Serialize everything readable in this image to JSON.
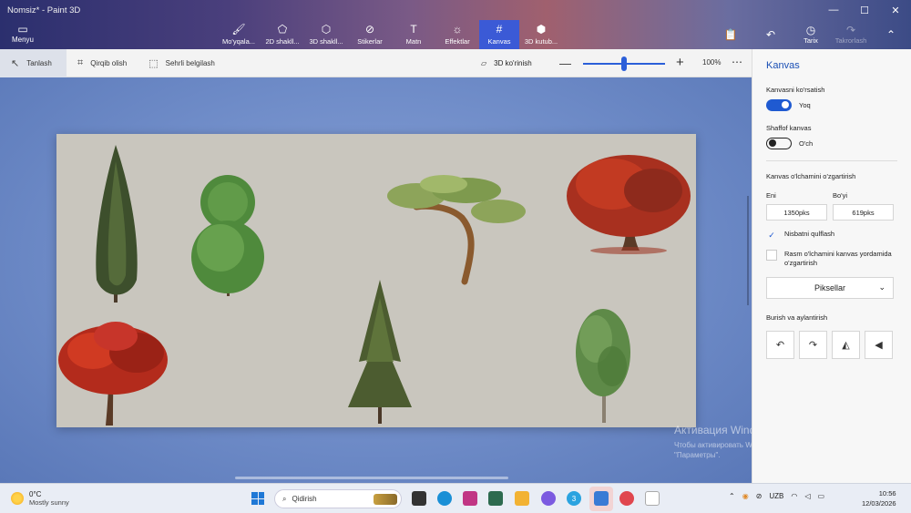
{
  "window": {
    "title": "Nomsiz* - Paint 3D"
  },
  "menu": {
    "label": "Menyu",
    "icon": "folder-icon"
  },
  "toolbar": {
    "tools": [
      {
        "label": "Mo'yqala...",
        "icon": "brush-icon"
      },
      {
        "label": "2D shakll...",
        "icon": "shapes-2d-icon"
      },
      {
        "label": "3D shakll...",
        "icon": "cube-icon"
      },
      {
        "label": "Stikerlar",
        "icon": "sticker-icon"
      },
      {
        "label": "Matn",
        "icon": "text-icon"
      },
      {
        "label": "Effektlar",
        "icon": "sun-icon"
      },
      {
        "label": "Kanvas",
        "icon": "canvas-crop-icon",
        "active": true
      },
      {
        "label": "3D kutub...",
        "icon": "library-icon"
      }
    ],
    "paste_icon": "paste-icon",
    "undo_icon": "undo-icon",
    "history_label": "Tarix",
    "redo_label": "Takrorlash"
  },
  "subbar": {
    "select_label": "Tanlash",
    "crop_label": "Qirqib olish",
    "magic_select_label": "Sehrli belgilash",
    "view3d_label": "3D ko'rinish",
    "zoom_value": "100%",
    "zoom_level_percent": 60
  },
  "panel": {
    "title": "Kanvas",
    "show_canvas_label": "Kanvasni ko'rsatish",
    "show_canvas_state": "Yoq",
    "transparent_label": "Shaffof kanvas",
    "transparent_state": "O'ch",
    "resize_label": "Kanvas o'lchamini o'zgartirish",
    "width_label": "Eni",
    "height_label": "Bo'yi",
    "width_value": "1350pks",
    "height_value": "619pks",
    "lock_ratio_label": "Nisbatni qulflash",
    "resize_image_label": "Rasm o'lchamini kanvas yordamida o'zgartirish",
    "units_value": "Piksellar",
    "rotate_label": "Burish va aylantirish"
  },
  "watermark": {
    "line1": "Активация Windows",
    "line2": "Чтобы активировать Windows, перейдите в раздел \"Параметры\"."
  },
  "taskbar": {
    "temperature": "0°C",
    "weather": "Mostly sunny",
    "search_placeholder": "Qidirish",
    "language": "UZB",
    "time": "10:56",
    "date": "12/03/2026",
    "telegram_badge": "3"
  },
  "colors": {
    "accent": "#3b5ad6",
    "toggle_on": "#1f5ad1",
    "canvas_bg": "#c9c6be"
  }
}
